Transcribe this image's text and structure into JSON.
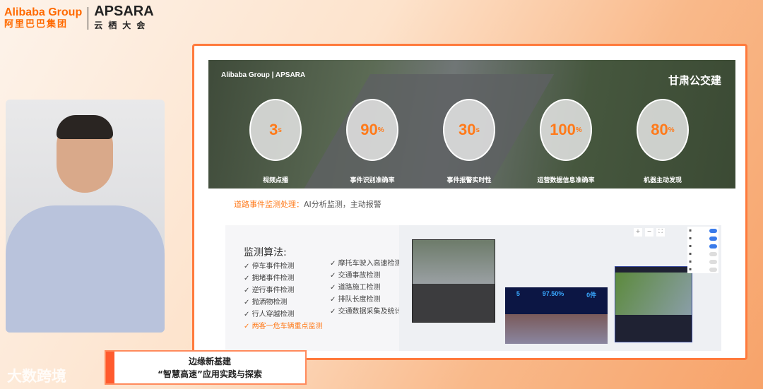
{
  "header": {
    "brand": "Alibaba Group",
    "brand_cn": "阿里巴巴集团",
    "event": "APSARA",
    "event_cn": "云栖大会"
  },
  "slide": {
    "partner_logo": "甘肃公交建",
    "metrics": [
      {
        "value": "3",
        "unit": "s",
        "label": "视频点播"
      },
      {
        "value": "90",
        "unit": "%",
        "label": "事件识别准确率"
      },
      {
        "value": "30",
        "unit": "s",
        "label": "事件报警实时性"
      },
      {
        "value": "100",
        "unit": "%",
        "label": "运营数据信息准确率"
      },
      {
        "value": "80",
        "unit": "%",
        "label": "机器主动发现"
      }
    ],
    "subtitle_highlight": "道路事件监测处理：",
    "subtitle_text": "AI分析监测，主动报警",
    "algo_title": "监测算法:",
    "algo_left": [
      "停车事件检测",
      "拥堵事件检测",
      "逆行事件检测",
      "抛洒物检测",
      "行人穿越检测"
    ],
    "algo_highlight": "两客一危车辆重点监测",
    "algo_right": [
      "摩托车驶入高速检测",
      "交通事故检测",
      "道路施工检测",
      "排队长度检测",
      "交通数据采集及统计"
    ],
    "dashboard": {
      "values": [
        "5",
        "97.50%",
        "0件"
      ]
    },
    "map_toggles": [
      {
        "on": true
      },
      {
        "on": true
      },
      {
        "on": true
      },
      {
        "on": false
      },
      {
        "on": false
      },
      {
        "on": false
      }
    ]
  },
  "caption": {
    "line1": "边缘新基建",
    "line2": "“智慧高速”应用实践与探索"
  },
  "watermark": "大数跨境"
}
